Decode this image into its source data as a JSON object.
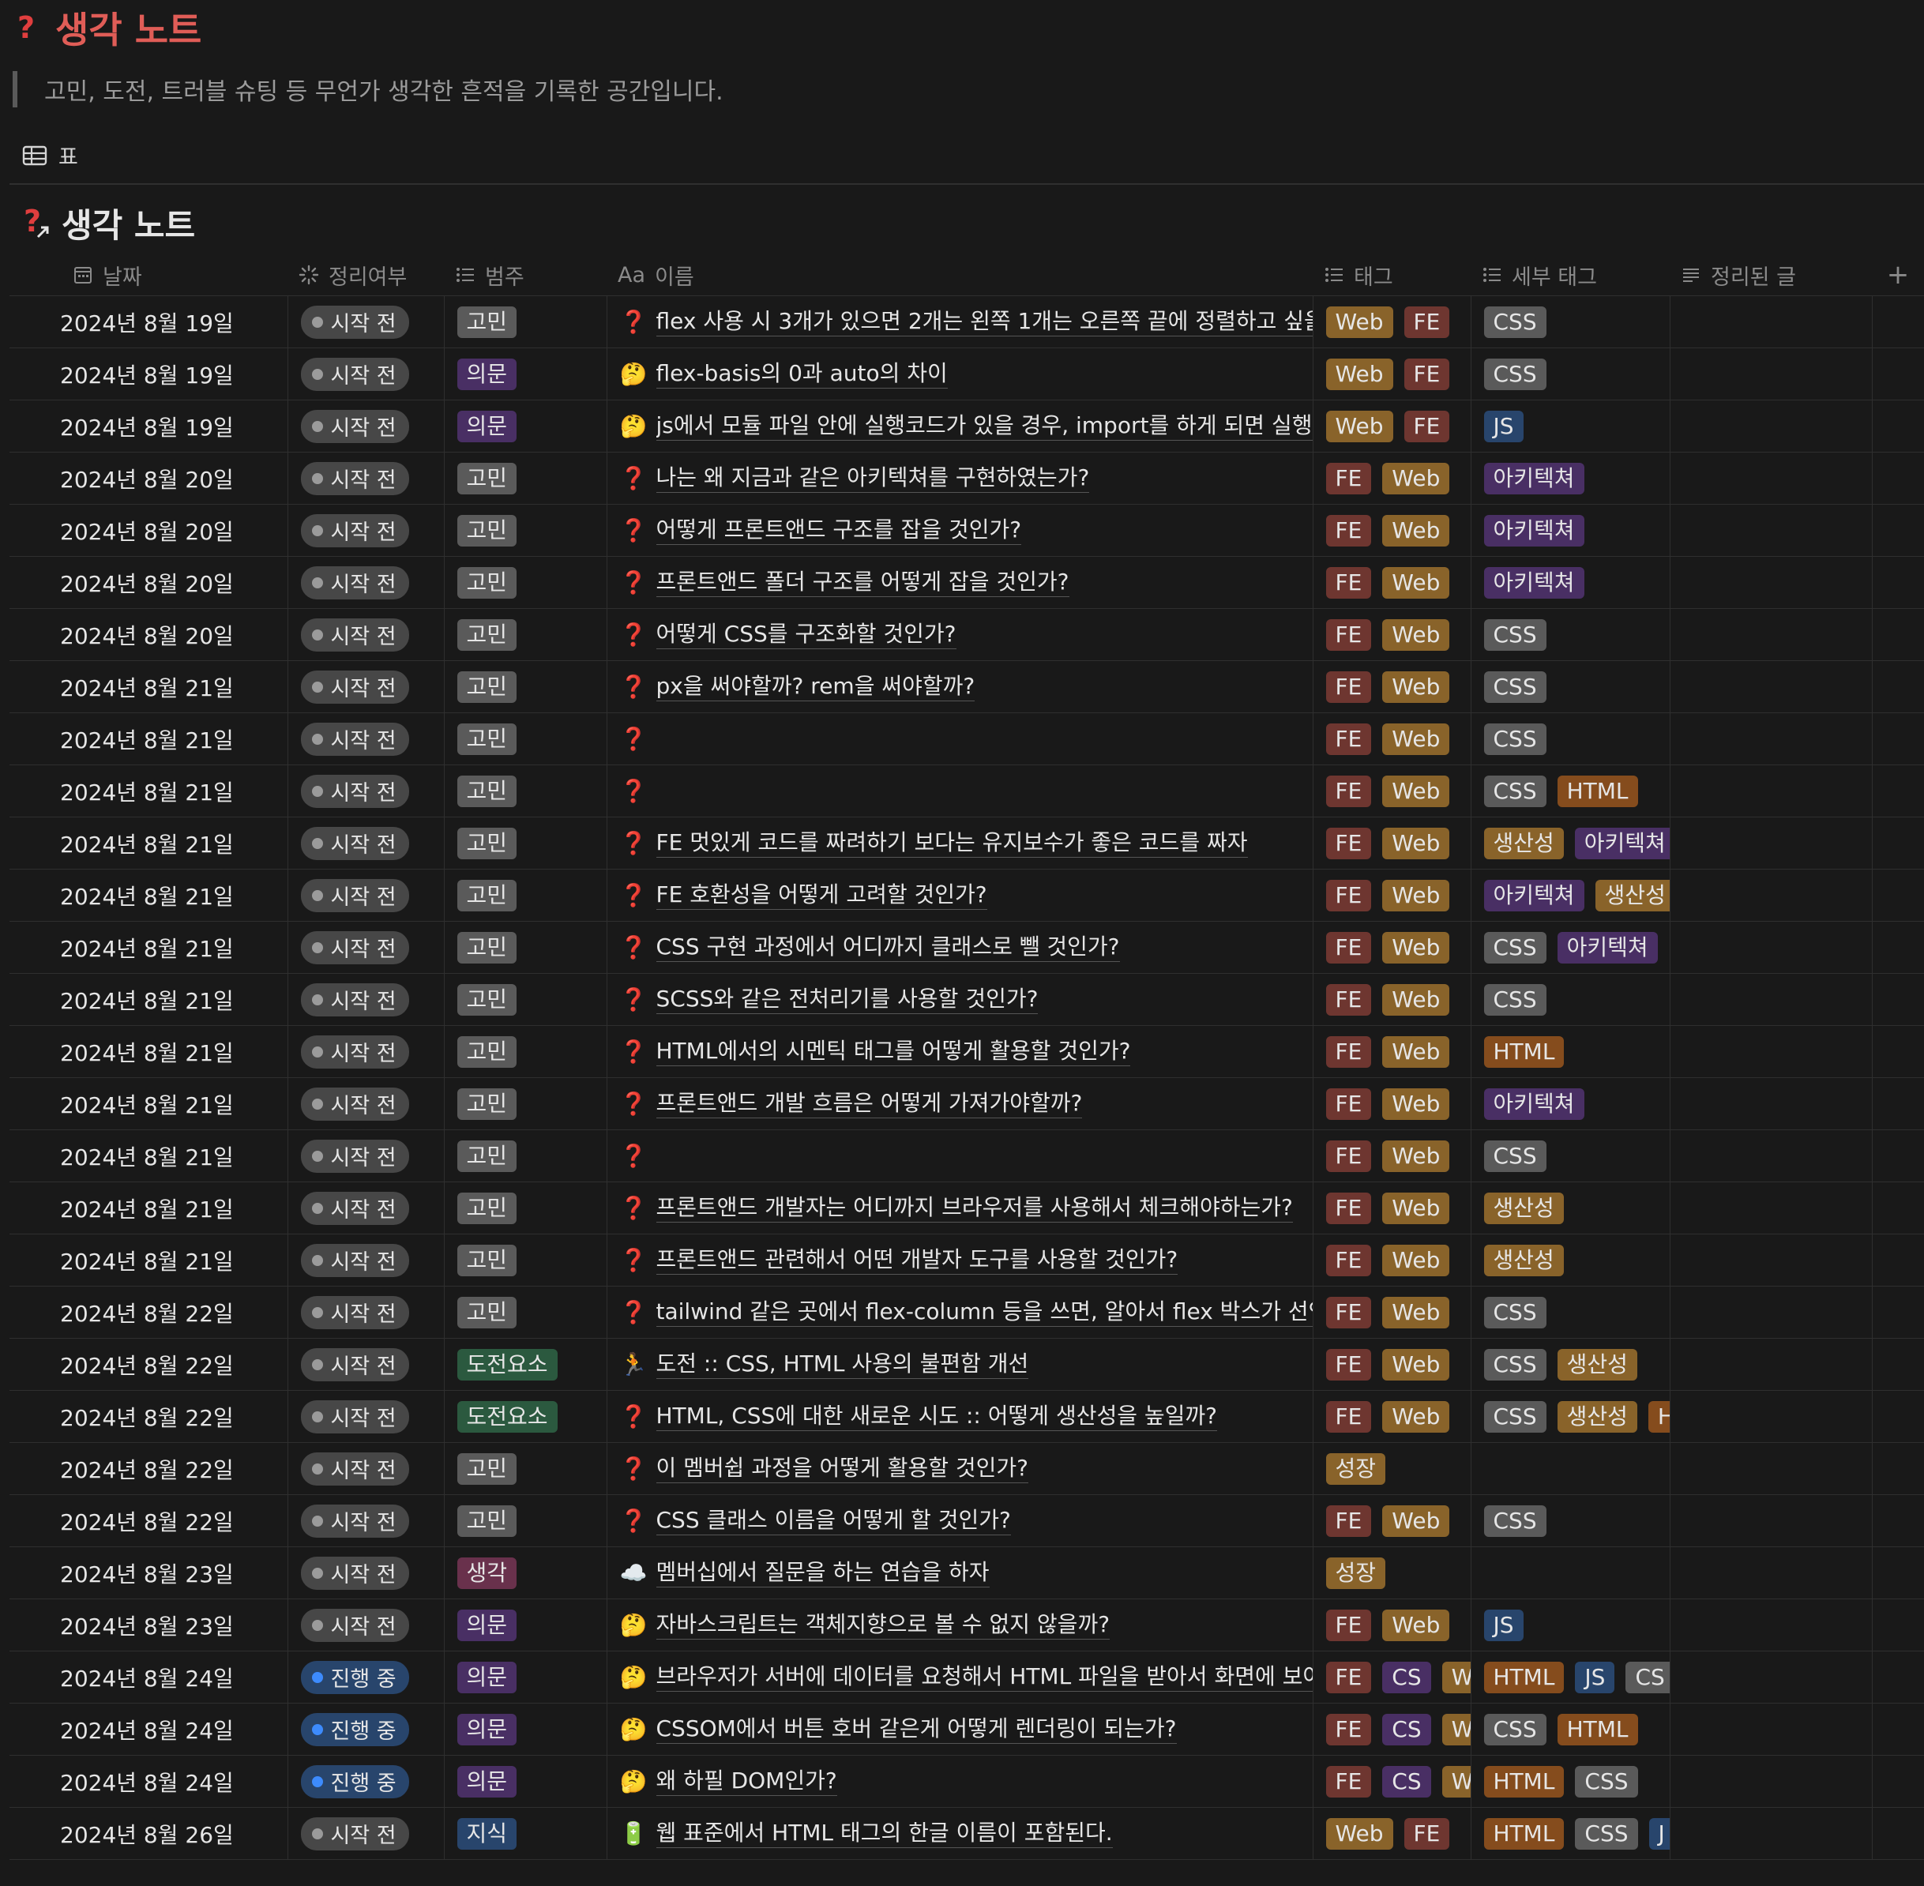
{
  "page": {
    "title": "생각 노트",
    "description": "고민, 도전, 트러블 슈팅 등 무언가 생각한 흔적을 기록한 공간입니다.",
    "view_tab_label": "표",
    "database_title": "생각 노트"
  },
  "columns": {
    "date": "날짜",
    "status": "정리여부",
    "category": "범주",
    "name_prefix": "Aa",
    "name": "이름",
    "tags": "태그",
    "sub_tags": "세부 태그",
    "summary": "정리된 글",
    "add": "+"
  },
  "colors": {
    "background": "#191919",
    "tag_Web": "#89632a",
    "tag_FE": "#6e3630",
    "tag_CS": "#492f64",
    "tag_growth": "#89632a",
    "sub_CSS": "#5a5a5a",
    "sub_JS": "#28456c",
    "sub_HTML": "#854c1d",
    "sub_arch": "#492f64",
    "sub_productivity": "#89632a",
    "cat_worry": "#5a5a5a",
    "cat_question": "#492f64",
    "cat_challenge": "#2b593f",
    "cat_thought": "#69314c",
    "cat_knowledge": "#28456c"
  },
  "rows": [
    {
      "date": "2024년 8월 19일",
      "status": "시작 전",
      "status_color": "gray",
      "category": "고민",
      "cat_color": "#5a5a5a",
      "icon": "❓",
      "icon_name": "question-icon",
      "name": "flex 사용 시 3개가 있으면 2개는 왼쪽 1개는 오른쪽 끝에 정렬하고 싶을 경우",
      "tags": [
        {
          "t": "Web",
          "c": "#89632a"
        },
        {
          "t": "FE",
          "c": "#6e3630"
        }
      ],
      "sub_tags": [
        {
          "t": "CSS",
          "c": "#5a5a5a"
        }
      ]
    },
    {
      "date": "2024년 8월 19일",
      "status": "시작 전",
      "status_color": "gray",
      "category": "의문",
      "cat_color": "#492f64",
      "icon": "🤔",
      "icon_name": "thinking-face-icon",
      "name": "flex-basis의 0과 auto의 차이",
      "tags": [
        {
          "t": "Web",
          "c": "#89632a"
        },
        {
          "t": "FE",
          "c": "#6e3630"
        }
      ],
      "sub_tags": [
        {
          "t": "CSS",
          "c": "#5a5a5a"
        }
      ]
    },
    {
      "date": "2024년 8월 19일",
      "status": "시작 전",
      "status_color": "gray",
      "category": "의문",
      "cat_color": "#492f64",
      "icon": "🤔",
      "icon_name": "thinking-face-icon",
      "name": "js에서 모듈 파일 안에 실행코드가 있을 경우, import를 하게 되면 실행코드가",
      "tags": [
        {
          "t": "Web",
          "c": "#89632a"
        },
        {
          "t": "FE",
          "c": "#6e3630"
        }
      ],
      "sub_tags": [
        {
          "t": "JS",
          "c": "#28456c"
        }
      ]
    },
    {
      "date": "2024년 8월 20일",
      "status": "시작 전",
      "status_color": "gray",
      "category": "고민",
      "cat_color": "#5a5a5a",
      "icon": "❓",
      "icon_name": "question-icon",
      "name": "나는 왜 지금과 같은 아키텍쳐를 구현하였는가?",
      "tags": [
        {
          "t": "FE",
          "c": "#6e3630"
        },
        {
          "t": "Web",
          "c": "#89632a"
        }
      ],
      "sub_tags": [
        {
          "t": "아키텍쳐",
          "c": "#492f64"
        }
      ]
    },
    {
      "date": "2024년 8월 20일",
      "status": "시작 전",
      "status_color": "gray",
      "category": "고민",
      "cat_color": "#5a5a5a",
      "icon": "❓",
      "icon_name": "question-icon",
      "name": "어떻게 프론트앤드 구조를 잡을 것인가?",
      "tags": [
        {
          "t": "FE",
          "c": "#6e3630"
        },
        {
          "t": "Web",
          "c": "#89632a"
        }
      ],
      "sub_tags": [
        {
          "t": "아키텍쳐",
          "c": "#492f64"
        }
      ]
    },
    {
      "date": "2024년 8월 20일",
      "status": "시작 전",
      "status_color": "gray",
      "category": "고민",
      "cat_color": "#5a5a5a",
      "icon": "❓",
      "icon_name": "question-icon",
      "name": "프론트앤드 폴더 구조를 어떻게 잡을 것인가?",
      "tags": [
        {
          "t": "FE",
          "c": "#6e3630"
        },
        {
          "t": "Web",
          "c": "#89632a"
        }
      ],
      "sub_tags": [
        {
          "t": "아키텍쳐",
          "c": "#492f64"
        }
      ]
    },
    {
      "date": "2024년 8월 20일",
      "status": "시작 전",
      "status_color": "gray",
      "category": "고민",
      "cat_color": "#5a5a5a",
      "icon": "❓",
      "icon_name": "question-icon",
      "name": "어떻게 CSS를 구조화할 것인가?",
      "tags": [
        {
          "t": "FE",
          "c": "#6e3630"
        },
        {
          "t": "Web",
          "c": "#89632a"
        }
      ],
      "sub_tags": [
        {
          "t": "CSS",
          "c": "#5a5a5a"
        }
      ]
    },
    {
      "date": "2024년 8월 21일",
      "status": "시작 전",
      "status_color": "gray",
      "category": "고민",
      "cat_color": "#5a5a5a",
      "icon": "❓",
      "icon_name": "question-icon",
      "name": "px을 써야할까? rem을 써야할까?",
      "tags": [
        {
          "t": "FE",
          "c": "#6e3630"
        },
        {
          "t": "Web",
          "c": "#89632a"
        }
      ],
      "sub_tags": [
        {
          "t": "CSS",
          "c": "#5a5a5a"
        }
      ]
    },
    {
      "date": "2024년 8월 21일",
      "status": "시작 전",
      "status_color": "gray",
      "category": "고민",
      "cat_color": "#5a5a5a",
      "icon": "❓",
      "icon_name": "question-icon",
      "name": "",
      "tags": [
        {
          "t": "FE",
          "c": "#6e3630"
        },
        {
          "t": "Web",
          "c": "#89632a"
        }
      ],
      "sub_tags": [
        {
          "t": "CSS",
          "c": "#5a5a5a"
        }
      ]
    },
    {
      "date": "2024년 8월 21일",
      "status": "시작 전",
      "status_color": "gray",
      "category": "고민",
      "cat_color": "#5a5a5a",
      "icon": "❓",
      "icon_name": "question-icon",
      "name": "",
      "tags": [
        {
          "t": "FE",
          "c": "#6e3630"
        },
        {
          "t": "Web",
          "c": "#89632a"
        }
      ],
      "sub_tags": [
        {
          "t": "CSS",
          "c": "#5a5a5a"
        },
        {
          "t": "HTML",
          "c": "#854c1d"
        }
      ]
    },
    {
      "date": "2024년 8월 21일",
      "status": "시작 전",
      "status_color": "gray",
      "category": "고민",
      "cat_color": "#5a5a5a",
      "icon": "❓",
      "icon_name": "question-icon",
      "name": "FE 멋있게 코드를 짜려하기 보다는 유지보수가 좋은 코드를 짜자",
      "tags": [
        {
          "t": "FE",
          "c": "#6e3630"
        },
        {
          "t": "Web",
          "c": "#89632a"
        }
      ],
      "sub_tags": [
        {
          "t": "생산성",
          "c": "#89632a"
        },
        {
          "t": "아키텍쳐",
          "c": "#492f64"
        }
      ]
    },
    {
      "date": "2024년 8월 21일",
      "status": "시작 전",
      "status_color": "gray",
      "category": "고민",
      "cat_color": "#5a5a5a",
      "icon": "❓",
      "icon_name": "question-icon",
      "name": "FE 호환성을 어떻게 고려할 것인가?",
      "tags": [
        {
          "t": "FE",
          "c": "#6e3630"
        },
        {
          "t": "Web",
          "c": "#89632a"
        }
      ],
      "sub_tags": [
        {
          "t": "아키텍쳐",
          "c": "#492f64"
        },
        {
          "t": "생산성",
          "c": "#89632a"
        }
      ]
    },
    {
      "date": "2024년 8월 21일",
      "status": "시작 전",
      "status_color": "gray",
      "category": "고민",
      "cat_color": "#5a5a5a",
      "icon": "❓",
      "icon_name": "question-icon",
      "name": "CSS 구현 과정에서 어디까지 클래스로 뺄 것인가?",
      "tags": [
        {
          "t": "FE",
          "c": "#6e3630"
        },
        {
          "t": "Web",
          "c": "#89632a"
        }
      ],
      "sub_tags": [
        {
          "t": "CSS",
          "c": "#5a5a5a"
        },
        {
          "t": "아키텍쳐",
          "c": "#492f64"
        }
      ]
    },
    {
      "date": "2024년 8월 21일",
      "status": "시작 전",
      "status_color": "gray",
      "category": "고민",
      "cat_color": "#5a5a5a",
      "icon": "❓",
      "icon_name": "question-icon",
      "name": "SCSS와 같은 전처리기를 사용할 것인가?",
      "tags": [
        {
          "t": "FE",
          "c": "#6e3630"
        },
        {
          "t": "Web",
          "c": "#89632a"
        }
      ],
      "sub_tags": [
        {
          "t": "CSS",
          "c": "#5a5a5a"
        }
      ]
    },
    {
      "date": "2024년 8월 21일",
      "status": "시작 전",
      "status_color": "gray",
      "category": "고민",
      "cat_color": "#5a5a5a",
      "icon": "❓",
      "icon_name": "question-icon",
      "name": "HTML에서의 시멘틱 태그를 어떻게 활용할 것인가?",
      "tags": [
        {
          "t": "FE",
          "c": "#6e3630"
        },
        {
          "t": "Web",
          "c": "#89632a"
        }
      ],
      "sub_tags": [
        {
          "t": "HTML",
          "c": "#854c1d"
        }
      ]
    },
    {
      "date": "2024년 8월 21일",
      "status": "시작 전",
      "status_color": "gray",
      "category": "고민",
      "cat_color": "#5a5a5a",
      "icon": "❓",
      "icon_name": "question-icon",
      "name": "프론트앤드 개발 흐름은 어떻게 가져가야할까?",
      "tags": [
        {
          "t": "FE",
          "c": "#6e3630"
        },
        {
          "t": "Web",
          "c": "#89632a"
        }
      ],
      "sub_tags": [
        {
          "t": "아키텍쳐",
          "c": "#492f64"
        }
      ]
    },
    {
      "date": "2024년 8월 21일",
      "status": "시작 전",
      "status_color": "gray",
      "category": "고민",
      "cat_color": "#5a5a5a",
      "icon": "❓",
      "icon_name": "question-icon",
      "name": "",
      "tags": [
        {
          "t": "FE",
          "c": "#6e3630"
        },
        {
          "t": "Web",
          "c": "#89632a"
        }
      ],
      "sub_tags": [
        {
          "t": "CSS",
          "c": "#5a5a5a"
        }
      ]
    },
    {
      "date": "2024년 8월 21일",
      "status": "시작 전",
      "status_color": "gray",
      "category": "고민",
      "cat_color": "#5a5a5a",
      "icon": "❓",
      "icon_name": "question-icon",
      "name": "프론트앤드 개발자는 어디까지 브라우저를 사용해서 체크해야하는가?",
      "tags": [
        {
          "t": "FE",
          "c": "#6e3630"
        },
        {
          "t": "Web",
          "c": "#89632a"
        }
      ],
      "sub_tags": [
        {
          "t": "생산성",
          "c": "#89632a"
        }
      ]
    },
    {
      "date": "2024년 8월 21일",
      "status": "시작 전",
      "status_color": "gray",
      "category": "고민",
      "cat_color": "#5a5a5a",
      "icon": "❓",
      "icon_name": "question-icon",
      "name": "프론트앤드 관련해서 어떤 개발자 도구를 사용할 것인가?",
      "tags": [
        {
          "t": "FE",
          "c": "#6e3630"
        },
        {
          "t": "Web",
          "c": "#89632a"
        }
      ],
      "sub_tags": [
        {
          "t": "생산성",
          "c": "#89632a"
        }
      ]
    },
    {
      "date": "2024년 8월 22일",
      "status": "시작 전",
      "status_color": "gray",
      "category": "고민",
      "cat_color": "#5a5a5a",
      "icon": "❓",
      "icon_name": "question-icon",
      "name": "tailwind 같은 곳에서 flex-column 등을 쓰면, 알아서 flex 박스가 선언되는",
      "tags": [
        {
          "t": "FE",
          "c": "#6e3630"
        },
        {
          "t": "Web",
          "c": "#89632a"
        }
      ],
      "sub_tags": [
        {
          "t": "CSS",
          "c": "#5a5a5a"
        }
      ]
    },
    {
      "date": "2024년 8월 22일",
      "status": "시작 전",
      "status_color": "gray",
      "category": "도전요소",
      "cat_color": "#2b593f",
      "icon": "🏃",
      "icon_name": "runner-icon",
      "name": "도전 :: CSS, HTML 사용의 불편함 개선",
      "tags": [
        {
          "t": "FE",
          "c": "#6e3630"
        },
        {
          "t": "Web",
          "c": "#89632a"
        }
      ],
      "sub_tags": [
        {
          "t": "CSS",
          "c": "#5a5a5a"
        },
        {
          "t": "생산성",
          "c": "#89632a"
        }
      ]
    },
    {
      "date": "2024년 8월 22일",
      "status": "시작 전",
      "status_color": "gray",
      "category": "도전요소",
      "cat_color": "#2b593f",
      "icon": "❓",
      "icon_name": "question-icon",
      "name": "HTML, CSS에 대한 새로운 시도 :: 어떻게 생산성을 높일까?",
      "tags": [
        {
          "t": "FE",
          "c": "#6e3630"
        },
        {
          "t": "Web",
          "c": "#89632a"
        }
      ],
      "sub_tags": [
        {
          "t": "CSS",
          "c": "#5a5a5a"
        },
        {
          "t": "생산성",
          "c": "#89632a"
        },
        {
          "t": "H",
          "c": "#854c1d"
        }
      ]
    },
    {
      "date": "2024년 8월 22일",
      "status": "시작 전",
      "status_color": "gray",
      "category": "고민",
      "cat_color": "#5a5a5a",
      "icon": "❓",
      "icon_name": "question-icon",
      "name": "이 멤버쉽 과정을 어떻게 활용할 것인가?",
      "tags": [
        {
          "t": "성장",
          "c": "#89632a"
        }
      ],
      "sub_tags": []
    },
    {
      "date": "2024년 8월 22일",
      "status": "시작 전",
      "status_color": "gray",
      "category": "고민",
      "cat_color": "#5a5a5a",
      "icon": "❓",
      "icon_name": "question-icon",
      "name": "CSS 클래스 이름을 어떻게 할 것인가?",
      "tags": [
        {
          "t": "FE",
          "c": "#6e3630"
        },
        {
          "t": "Web",
          "c": "#89632a"
        }
      ],
      "sub_tags": [
        {
          "t": "CSS",
          "c": "#5a5a5a"
        }
      ]
    },
    {
      "date": "2024년 8월 23일",
      "status": "시작 전",
      "status_color": "gray",
      "category": "생각",
      "cat_color": "#69314c",
      "icon": "☁️",
      "icon_name": "cloud-icon",
      "name": "멤버십에서 질문을 하는 연습을 하자",
      "tags": [
        {
          "t": "성장",
          "c": "#89632a"
        }
      ],
      "sub_tags": []
    },
    {
      "date": "2024년 8월 23일",
      "status": "시작 전",
      "status_color": "gray",
      "category": "의문",
      "cat_color": "#492f64",
      "icon": "🤔",
      "icon_name": "thinking-face-icon",
      "name": "자바스크립트는 객체지향으로 볼 수 없지 않을까?",
      "tags": [
        {
          "t": "FE",
          "c": "#6e3630"
        },
        {
          "t": "Web",
          "c": "#89632a"
        }
      ],
      "sub_tags": [
        {
          "t": "JS",
          "c": "#28456c"
        }
      ]
    },
    {
      "date": "2024년 8월 24일",
      "status": "진행 중",
      "status_color": "blue",
      "category": "의문",
      "cat_color": "#492f64",
      "icon": "🤔",
      "icon_name": "thinking-face-icon",
      "name": "브라우저가 서버에 데이터를 요청해서 HTML 파일을 받아서 화면에 보여주기",
      "tags": [
        {
          "t": "FE",
          "c": "#6e3630"
        },
        {
          "t": "CS",
          "c": "#492f64"
        },
        {
          "t": "W",
          "c": "#89632a"
        }
      ],
      "sub_tags": [
        {
          "t": "HTML",
          "c": "#854c1d"
        },
        {
          "t": "JS",
          "c": "#28456c"
        },
        {
          "t": "CS",
          "c": "#5a5a5a"
        }
      ]
    },
    {
      "date": "2024년 8월 24일",
      "status": "진행 중",
      "status_color": "blue",
      "category": "의문",
      "cat_color": "#492f64",
      "icon": "🤔",
      "icon_name": "thinking-face-icon",
      "name": "CSSOM에서 버튼 호버 같은게 어떻게 렌더링이 되는가?",
      "tags": [
        {
          "t": "FE",
          "c": "#6e3630"
        },
        {
          "t": "CS",
          "c": "#492f64"
        },
        {
          "t": "W",
          "c": "#89632a"
        }
      ],
      "sub_tags": [
        {
          "t": "CSS",
          "c": "#5a5a5a"
        },
        {
          "t": "HTML",
          "c": "#854c1d"
        }
      ]
    },
    {
      "date": "2024년 8월 24일",
      "status": "진행 중",
      "status_color": "blue",
      "category": "의문",
      "cat_color": "#492f64",
      "icon": "🤔",
      "icon_name": "thinking-face-icon",
      "name": "왜 하필 DOM인가?",
      "tags": [
        {
          "t": "FE",
          "c": "#6e3630"
        },
        {
          "t": "CS",
          "c": "#492f64"
        },
        {
          "t": "W",
          "c": "#89632a"
        }
      ],
      "sub_tags": [
        {
          "t": "HTML",
          "c": "#854c1d"
        },
        {
          "t": "CSS",
          "c": "#5a5a5a"
        }
      ]
    },
    {
      "date": "2024년 8월 26일",
      "status": "시작 전",
      "status_color": "gray",
      "category": "지식",
      "cat_color": "#28456c",
      "icon": "🔋",
      "icon_name": "battery-icon",
      "name": "웹 표준에서 HTML 태그의 한글 이름이 포함된다.",
      "tags": [
        {
          "t": "Web",
          "c": "#89632a"
        },
        {
          "t": "FE",
          "c": "#6e3630"
        }
      ],
      "sub_tags": [
        {
          "t": "HTML",
          "c": "#854c1d"
        },
        {
          "t": "CSS",
          "c": "#5a5a5a"
        },
        {
          "t": "J",
          "c": "#28456c"
        }
      ]
    }
  ]
}
